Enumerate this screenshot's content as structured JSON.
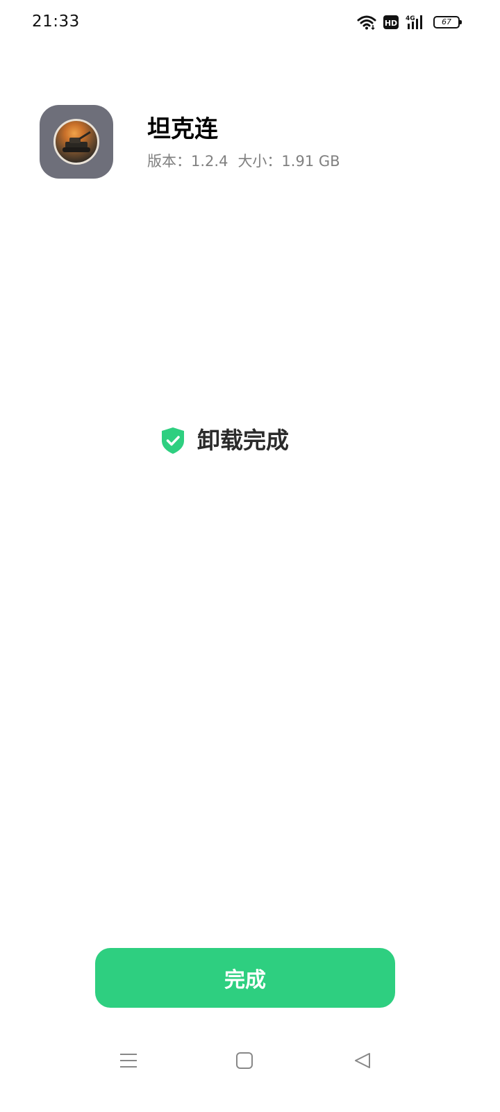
{
  "status_bar": {
    "time": "21:33",
    "hd_label": "HD",
    "network_label": "4G",
    "battery": "67",
    "icons": [
      "wifi-icon",
      "hd-voice-icon",
      "signal-4g-icon",
      "battery-icon"
    ]
  },
  "app": {
    "name": "坦克连",
    "version_text": "版本：1.2.4",
    "size_text": "大小：1.91 GB",
    "icon": "tank-game-app-icon"
  },
  "result": {
    "icon": "shield-check-icon",
    "text": "卸载完成"
  },
  "actions": {
    "done_label": "完成"
  },
  "nav_bar": {
    "items": [
      "menu-icon",
      "home-icon",
      "back-icon"
    ]
  },
  "colors": {
    "accent": "#2ecf80",
    "icon_background": "#6e6f7a",
    "meta_text": "#808080"
  }
}
